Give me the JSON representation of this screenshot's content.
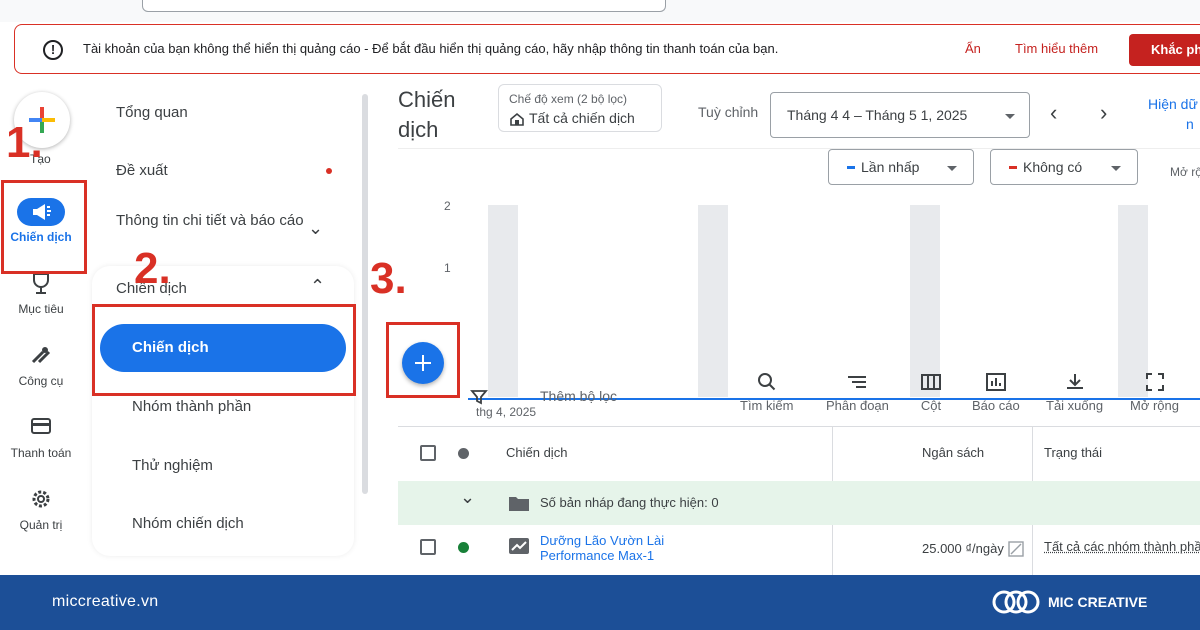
{
  "alert": {
    "message": "Tài khoản của bạn không thể hiển thị quảng cáo - Để bắt đầu hiển thị quảng cáo, hãy nhập thông tin thanh toán của bạn.",
    "hide_label": "Ẩn",
    "learn_label": "Tìm hiểu thêm",
    "fix_label": "Khắc phục"
  },
  "rail": {
    "create_label": "Tạo",
    "items": [
      {
        "label": "Chiến dịch",
        "icon": "megaphone-icon",
        "active": true
      },
      {
        "label": "Mục tiêu",
        "icon": "trophy-icon"
      },
      {
        "label": "Công cụ",
        "icon": "tools-icon"
      },
      {
        "label": "Thanh toán",
        "icon": "credit-card-icon"
      },
      {
        "label": "Quản trị",
        "icon": "gear-icon"
      }
    ]
  },
  "nav": {
    "overview": "Tổng quan",
    "recommendations": "Đề xuất",
    "insights": "Thông tin chi tiết và báo cáo",
    "campaigns_group": "Chiến dịch",
    "selected": "Chiến dịch",
    "asset_groups": "Nhóm thành phần",
    "experiments": "Thử nghiệm",
    "campaign_groups": "Nhóm chiến dịch"
  },
  "header": {
    "title": "Chiến dịch",
    "view_mode_label": "Chế độ xem (2 bộ lọc)",
    "view_mode_value": "Tất cả chiến dịch",
    "custom_label": "Tuỳ chỉnh",
    "date_range": "Tháng 4 4 – Tháng 5 1, 2025",
    "show_link": "Hiện dữ",
    "show_link2": "n"
  },
  "chart": {
    "metric1": "Lần nhấp",
    "metric2": "Không có",
    "expand_label": "Mở rộ",
    "x_start": "thg 4, 2025",
    "colors": {
      "metric1": "#1a73e8",
      "metric2": "#d93025"
    }
  },
  "chart_data": {
    "type": "line",
    "x": [
      "thg 4, 2025"
    ],
    "series": [
      {
        "name": "Lần nhấp",
        "values": [
          0
        ]
      }
    ],
    "ylim": [
      0,
      2
    ],
    "yticks": [
      "2",
      "1"
    ]
  },
  "toolbar": {
    "add_filter": "Thêm bộ lọc",
    "tools": [
      {
        "label": "Tìm kiếm",
        "icon": "search-icon"
      },
      {
        "label": "Phân đoạn",
        "icon": "segment-icon"
      },
      {
        "label": "Cột",
        "icon": "columns-icon"
      },
      {
        "label": "Báo cáo",
        "icon": "report-icon"
      },
      {
        "label": "Tải xuống",
        "icon": "download-icon"
      },
      {
        "label": "Mở rộng",
        "icon": "expand-icon"
      }
    ]
  },
  "table": {
    "columns": [
      "Chiến dịch",
      "Ngân sách",
      "Trạng thái"
    ],
    "draft_row": "Số bản nháp đang thực hiện: 0",
    "rows": [
      {
        "name_line1": "Dưỡng Lão Vườn Lài",
        "name_line2": "Performance Max-1",
        "budget": "25.000 ₫/ngày",
        "status": "Tất cả các nhóm thành phầ"
      }
    ]
  },
  "steps": [
    "1.",
    "2.",
    "3."
  ],
  "footer": {
    "site": "miccreative.vn",
    "brand": "MIC CREATIVE"
  }
}
